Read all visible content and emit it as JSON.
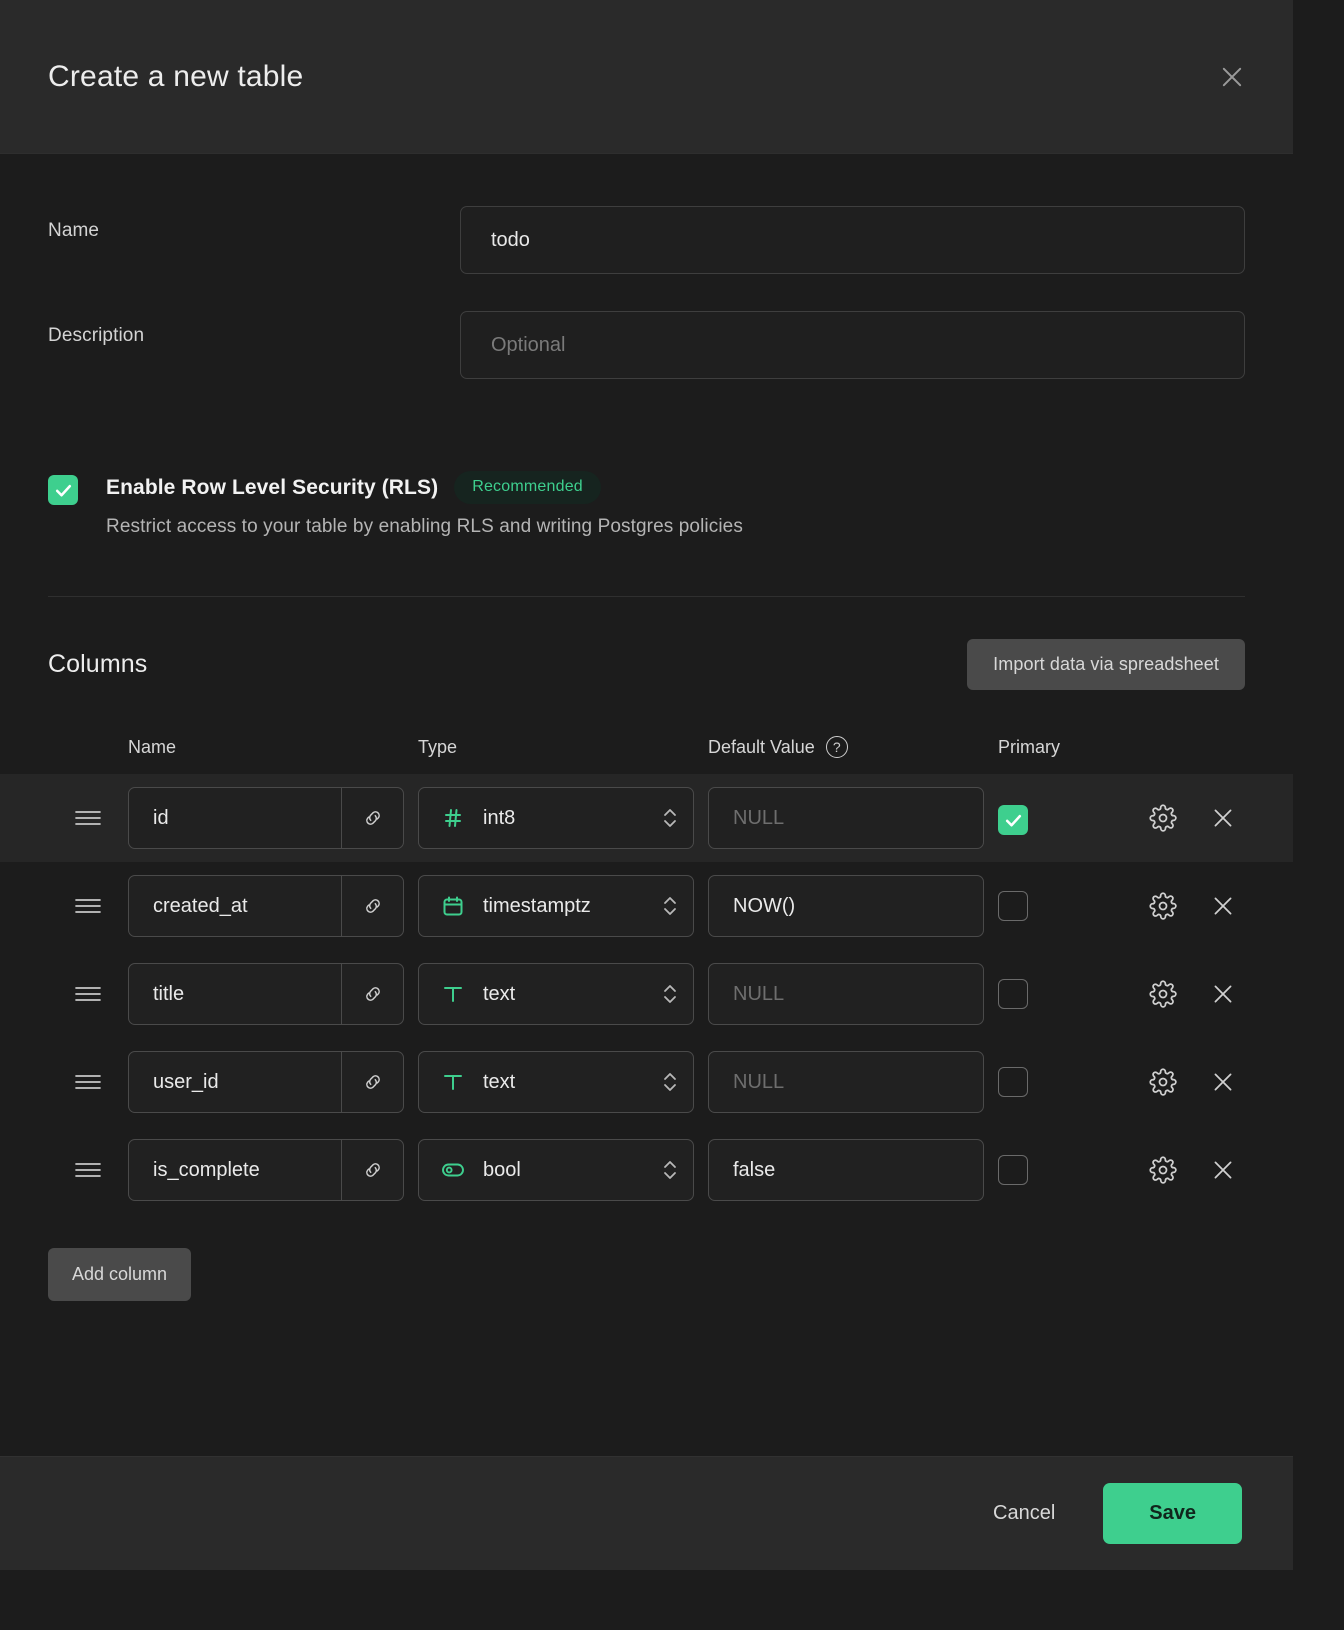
{
  "header": {
    "title": "Create a new table",
    "close_icon": "close-icon"
  },
  "form": {
    "name_label": "Name",
    "name_value": "todo",
    "description_label": "Description",
    "description_placeholder": "Optional"
  },
  "rls": {
    "checked": true,
    "title": "Enable Row Level Security (RLS)",
    "badge": "Recommended",
    "subtitle": "Restrict access to your table by enabling RLS and writing Postgres policies"
  },
  "columns_section": {
    "title": "Columns",
    "import_label": "Import data via spreadsheet",
    "headers": {
      "name": "Name",
      "type": "Type",
      "default_value": "Default Value",
      "help_icon": "?",
      "primary": "Primary"
    },
    "add_column_label": "Add column",
    "rows": [
      {
        "name": "id",
        "type": "int8",
        "type_icon": "hash-icon",
        "default": "NULL",
        "default_is_placeholder": true,
        "primary": true
      },
      {
        "name": "created_at",
        "type": "timestamptz",
        "type_icon": "calendar-icon",
        "default": "NOW()",
        "default_is_placeholder": false,
        "primary": false
      },
      {
        "name": "title",
        "type": "text",
        "type_icon": "text-icon",
        "default": "NULL",
        "default_is_placeholder": true,
        "primary": false
      },
      {
        "name": "user_id",
        "type": "text",
        "type_icon": "text-icon",
        "default": "NULL",
        "default_is_placeholder": true,
        "primary": false
      },
      {
        "name": "is_complete",
        "type": "bool",
        "type_icon": "toggle-icon",
        "default": "false",
        "default_is_placeholder": false,
        "primary": false
      }
    ]
  },
  "footer": {
    "cancel_label": "Cancel",
    "save_label": "Save"
  },
  "colors": {
    "accent_green": "#3ecf8e",
    "badge_bg": "#16241f",
    "panel_bg": "#1c1c1c",
    "header_bg": "#2a2a2a",
    "row_highlight": "#262626"
  }
}
